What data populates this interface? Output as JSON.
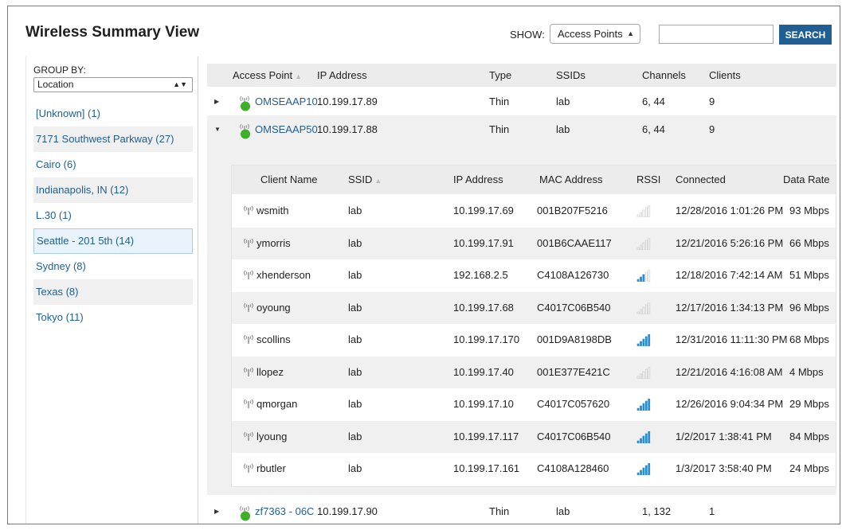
{
  "page_title": "Wireless Summary View",
  "toolbar": {
    "show_label": "SHOW:",
    "show_value": "Access Points",
    "search_placeholder": "",
    "search_label": "SEARCH"
  },
  "sidebar": {
    "group_by_label": "GROUP BY:",
    "group_by_value": "Location",
    "locations": [
      {
        "label": "[Unknown] (1)",
        "shaded": false,
        "selected": false
      },
      {
        "label": "7171 Southwest Parkway (27)",
        "shaded": true,
        "selected": false
      },
      {
        "label": "Cairo (6)",
        "shaded": false,
        "selected": false
      },
      {
        "label": "Indianapolis, IN (12)",
        "shaded": true,
        "selected": false
      },
      {
        "label": "L.30 (1)",
        "shaded": false,
        "selected": false
      },
      {
        "label": "Seattle - 201 5th (14)",
        "shaded": false,
        "selected": true
      },
      {
        "label": "Sydney (8)",
        "shaded": false,
        "selected": false
      },
      {
        "label": "Texas (8)",
        "shaded": true,
        "selected": false
      },
      {
        "label": "Tokyo (11)",
        "shaded": false,
        "selected": false
      }
    ]
  },
  "ap_table": {
    "columns": {
      "access_point": "Access Point",
      "ip_address": "IP Address",
      "type": "Type",
      "ssids": "SSIDs",
      "channels": "Channels",
      "clients": "Clients"
    },
    "rows": [
      {
        "name": "OMSEAAP10",
        "ip": "10.199.17.89",
        "type": "Thin",
        "ssids": "lab",
        "channels": "6, 44",
        "clients": "9",
        "expanded": false
      },
      {
        "name": "OMSEAAP50",
        "ip": "10.199.17.88",
        "type": "Thin",
        "ssids": "lab",
        "channels": "6, 44",
        "clients": "9",
        "expanded": true
      },
      {
        "name": "zf7363 - 06C",
        "ip": "10.199.17.90",
        "type": "Thin",
        "ssids": "lab",
        "channels": "1, 132",
        "clients": "1",
        "expanded": false
      }
    ]
  },
  "client_table": {
    "columns": {
      "client_name": "Client Name",
      "ssid": "SSID",
      "ip_address": "IP Address",
      "mac_address": "MAC Address",
      "rssi": "RSSI",
      "connected": "Connected",
      "data_rate": "Data Rate"
    },
    "rows": [
      {
        "name": "wsmith",
        "ssid": "lab",
        "ip": "10.199.17.69",
        "mac": "001B207F5216",
        "rssi_bars": 0,
        "connected": "12/28/2016 1:01:26 PM",
        "rate": "93 Mbps"
      },
      {
        "name": "ymorris",
        "ssid": "lab",
        "ip": "10.199.17.91",
        "mac": "001B6CAAE117",
        "rssi_bars": 0,
        "connected": "12/21/2016 5:26:16 PM",
        "rate": "66 Mbps"
      },
      {
        "name": "xhenderson",
        "ssid": "lab",
        "ip": "192.168.2.5",
        "mac": "C4108A126730",
        "rssi_bars": 3,
        "connected": "12/18/2016 7:42:14 AM",
        "rate": "51 Mbps"
      },
      {
        "name": "oyoung",
        "ssid": "lab",
        "ip": "10.199.17.68",
        "mac": "C4017C06B540",
        "rssi_bars": 0,
        "connected": "12/17/2016 1:34:13 PM",
        "rate": "96 Mbps"
      },
      {
        "name": "scollins",
        "ssid": "lab",
        "ip": "10.199.17.170",
        "mac": "001D9A8198DB",
        "rssi_bars": 5,
        "connected": "12/31/2016 11:11:30 PM",
        "rate": "68 Mbps"
      },
      {
        "name": "llopez",
        "ssid": "lab",
        "ip": "10.199.17.40",
        "mac": "001E377E421C",
        "rssi_bars": 0,
        "connected": "12/21/2016 4:16:08 AM",
        "rate": "4 Mbps"
      },
      {
        "name": "qmorgan",
        "ssid": "lab",
        "ip": "10.199.17.10",
        "mac": "C4017C057620",
        "rssi_bars": 5,
        "connected": "12/26/2016 9:04:34 PM",
        "rate": "29 Mbps"
      },
      {
        "name": "lyoung",
        "ssid": "lab",
        "ip": "10.199.17.117",
        "mac": "C4017C06B540",
        "rssi_bars": 5,
        "connected": "1/2/2017 1:38:41 PM",
        "rate": "84 Mbps"
      },
      {
        "name": "rbutler",
        "ssid": "lab",
        "ip": "10.199.17.161",
        "mac": "C4108A128460",
        "rssi_bars": 5,
        "connected": "1/3/2017 3:58:40 PM",
        "rate": "24 Mbps"
      }
    ]
  },
  "colors": {
    "link": "#1f5f93",
    "button": "#1f5f93",
    "status_online": "#3fae2a",
    "rssi_active": "#2a8fd0",
    "rssi_inactive": "#c8c8c8"
  }
}
